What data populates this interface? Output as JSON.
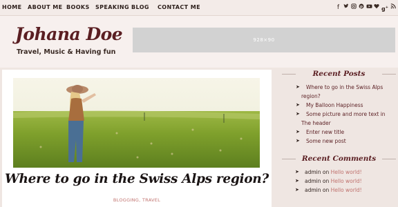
{
  "nav": {
    "items": [
      "HOME",
      "ABOUT ME",
      "BOOKS",
      "SPEAKING",
      "BLOG",
      "CONTACT ME"
    ]
  },
  "social_icons": [
    "facebook-icon",
    "twitter-icon",
    "instagram-icon",
    "pinterest-icon",
    "youtube-icon",
    "heart-icon",
    "google-plus-icon",
    "rss-icon"
  ],
  "header": {
    "logo": "Johana Doe",
    "tagline": "Travel, Music & Having fun",
    "ad_label": "928×90"
  },
  "post": {
    "title": "Where to go in the Swiss Alps region?",
    "categories": "BLOGGING, TRAVEL"
  },
  "sidebar": {
    "recent_posts_title": "Recent Posts",
    "recent_posts": [
      {
        "line1": "Where to go in the Swiss Alps",
        "line2": "region?"
      },
      {
        "line1": "My Balloon Happiness",
        "line2": ""
      },
      {
        "line1": "Some picture and more text in",
        "line2": "The header"
      },
      {
        "line1": "Enter new title",
        "line2": ""
      },
      {
        "line1": "Some new post",
        "line2": ""
      }
    ],
    "recent_comments_title": "Recent Comments",
    "recent_comments": [
      {
        "author": "admin",
        "on": "on",
        "link": "Hello world!"
      },
      {
        "author": "admin",
        "on": "on",
        "link": "Hello world!"
      },
      {
        "author": "admin",
        "on": "on",
        "link": "Hello world!"
      }
    ]
  },
  "colors": {
    "accent": "#5a1e22",
    "link": "#c0726e",
    "background": "#efe6e2"
  }
}
